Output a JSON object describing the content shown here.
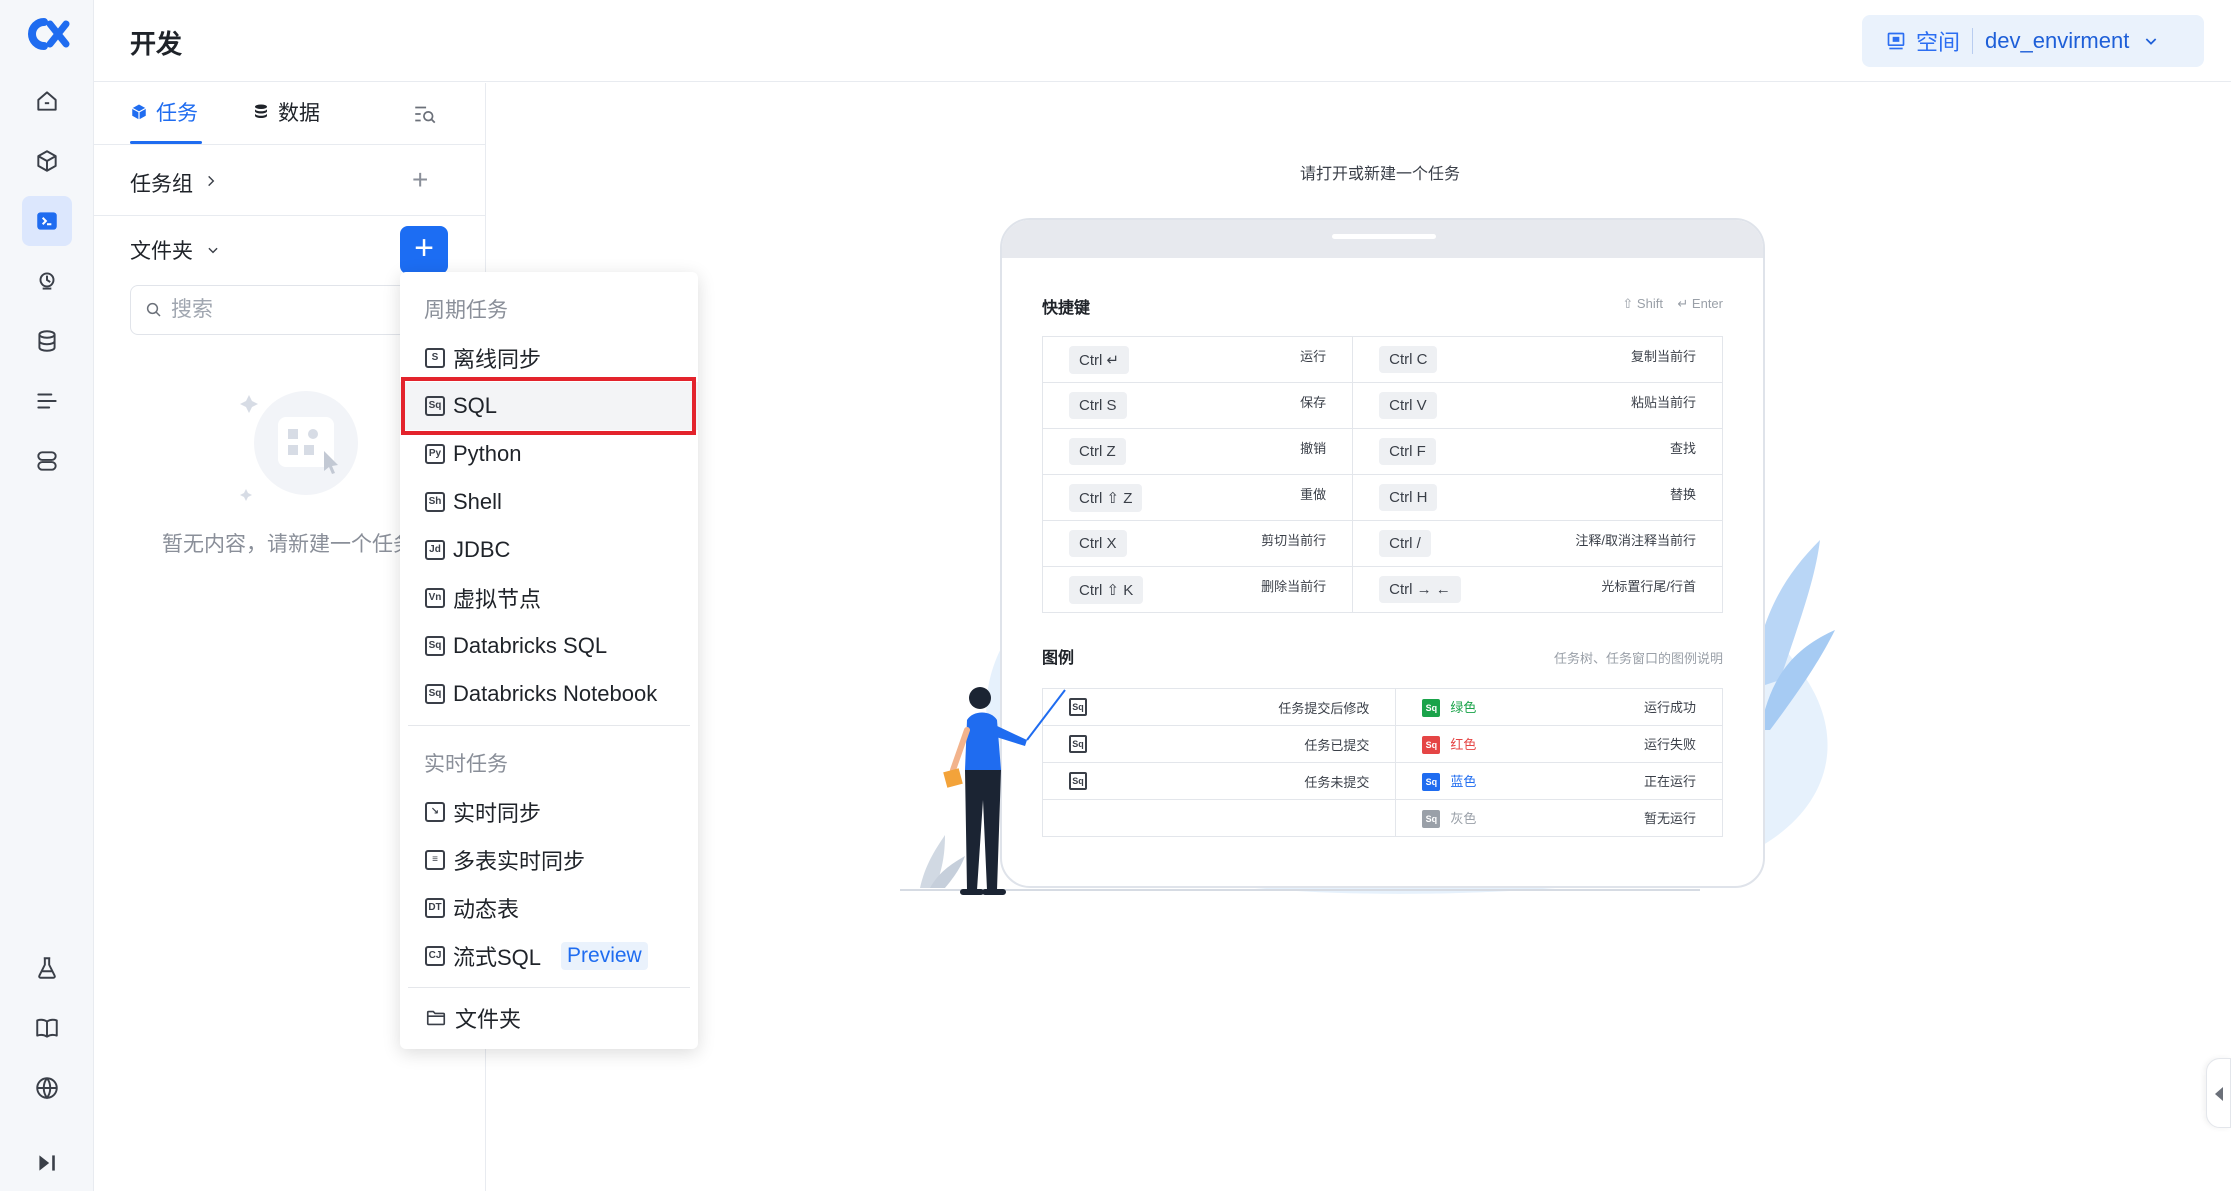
{
  "header": {
    "title": "开发",
    "space_label": "空间",
    "env_value": "dev_envirment"
  },
  "panel": {
    "tabs": [
      {
        "label": "任务",
        "active": true
      },
      {
        "label": "数据",
        "active": false
      }
    ],
    "task_group_label": "任务组",
    "folder_label": "文件夹",
    "search_placeholder": "搜索",
    "empty_text": "暂无内容，请新建一个任务"
  },
  "dropdown": {
    "periodic_title": "周期任务",
    "periodic_items": [
      {
        "label": "离线同步",
        "icon": "offline-sync-icon",
        "glyph": "S"
      },
      {
        "label": "SQL",
        "icon": "sql-icon",
        "glyph": "Sq"
      },
      {
        "label": "Python",
        "icon": "python-icon",
        "glyph": "Py"
      },
      {
        "label": "Shell",
        "icon": "shell-icon",
        "glyph": "Sh"
      },
      {
        "label": "JDBC",
        "icon": "jdbc-icon",
        "glyph": "Jd"
      },
      {
        "label": "虚拟节点",
        "icon": "virtual-node-icon",
        "glyph": "Vn"
      },
      {
        "label": "Databricks SQL",
        "icon": "databricks-sql-icon",
        "glyph": "Sq"
      },
      {
        "label": "Databricks Notebook",
        "icon": "databricks-notebook-icon",
        "glyph": "Sq"
      }
    ],
    "realtime_title": "实时任务",
    "realtime_items": [
      {
        "label": "实时同步",
        "icon": "realtime-sync-icon",
        "glyph": "↘"
      },
      {
        "label": "多表实时同步",
        "icon": "multi-table-sync-icon",
        "glyph": "≡"
      },
      {
        "label": "动态表",
        "icon": "dynamic-table-icon",
        "glyph": "DT"
      },
      {
        "label": "流式SQL",
        "icon": "stream-sql-icon",
        "glyph": "CJ"
      }
    ],
    "preview_tag": "Preview",
    "folder_item": "文件夹"
  },
  "main": {
    "hint": "请打开或新建一个任务",
    "shortcuts_title": "快捷键",
    "shift_label": "Shift",
    "enter_label": "Enter",
    "shortcuts": [
      {
        "lkey": "Ctrl ↵",
        "laction": "运行",
        "rkey": "Ctrl  C",
        "raction": "复制当前行"
      },
      {
        "lkey": "Ctrl  S",
        "laction": "保存",
        "rkey": "Ctrl  V",
        "raction": "粘贴当前行"
      },
      {
        "lkey": "Ctrl  Z",
        "laction": "撤销",
        "rkey": "Ctrl  F",
        "raction": "查找"
      },
      {
        "lkey": "Ctrl ⇧ Z",
        "laction": "重做",
        "rkey": "Ctrl  H",
        "raction": "替换"
      },
      {
        "lkey": "Ctrl  X",
        "laction": "剪切当前行",
        "rkey": "Ctrl  /",
        "raction": "注释/取消注释当前行"
      },
      {
        "lkey": "Ctrl ⇧ K",
        "laction": "删除当前行",
        "rkey": "Ctrl → ←",
        "raction": "光标置行尾/行首"
      }
    ],
    "legend_title": "图例",
    "legend_note": "任务树、任务窗口的图例说明",
    "legend": [
      {
        "ldesc": "任务提交后修改",
        "color_name": "绿色",
        "color": "#1aa34a",
        "rdesc": "运行成功"
      },
      {
        "ldesc": "任务已提交",
        "color_name": "红色",
        "color": "#e54545",
        "rdesc": "运行失败"
      },
      {
        "ldesc": "任务未提交",
        "color_name": "蓝色",
        "color": "#1f6cf0",
        "rdesc": "正在运行"
      },
      {
        "ldesc": "",
        "color_name": "灰色",
        "color": "#9aa0a8",
        "rdesc": "暂无运行"
      }
    ],
    "sq_glyph": "Sq"
  },
  "colors": {
    "accent": "#1f6cf0",
    "highlight_frame": "#e3232c"
  }
}
